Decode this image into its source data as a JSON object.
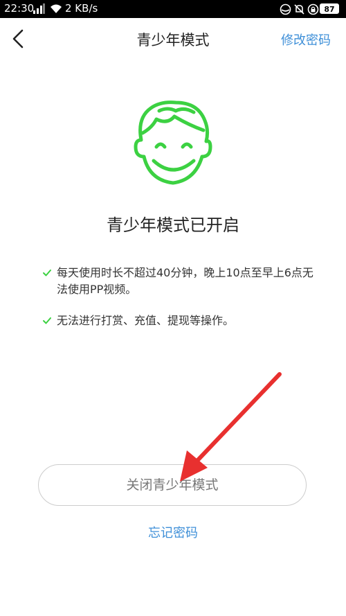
{
  "status_bar": {
    "time": "22:30",
    "network_speed": "2 KB/s",
    "battery": "87"
  },
  "nav": {
    "title": "青少年模式",
    "action": "修改密码"
  },
  "main": {
    "status_title": "青少年模式已开启",
    "rules": [
      "每天使用时长不超过40分钟，晚上10点至早上6点无法使用PP视频。",
      "无法进行打赏、充值、提现等操作。"
    ]
  },
  "buttons": {
    "close": "关闭青少年模式",
    "forgot": "忘记密码"
  },
  "colors": {
    "accent_blue": "#3e8fd8",
    "face_green": "#3cd142",
    "arrow_red": "#e8302f"
  },
  "icons": {
    "face": "smiling-face-icon",
    "check": "check-icon"
  }
}
